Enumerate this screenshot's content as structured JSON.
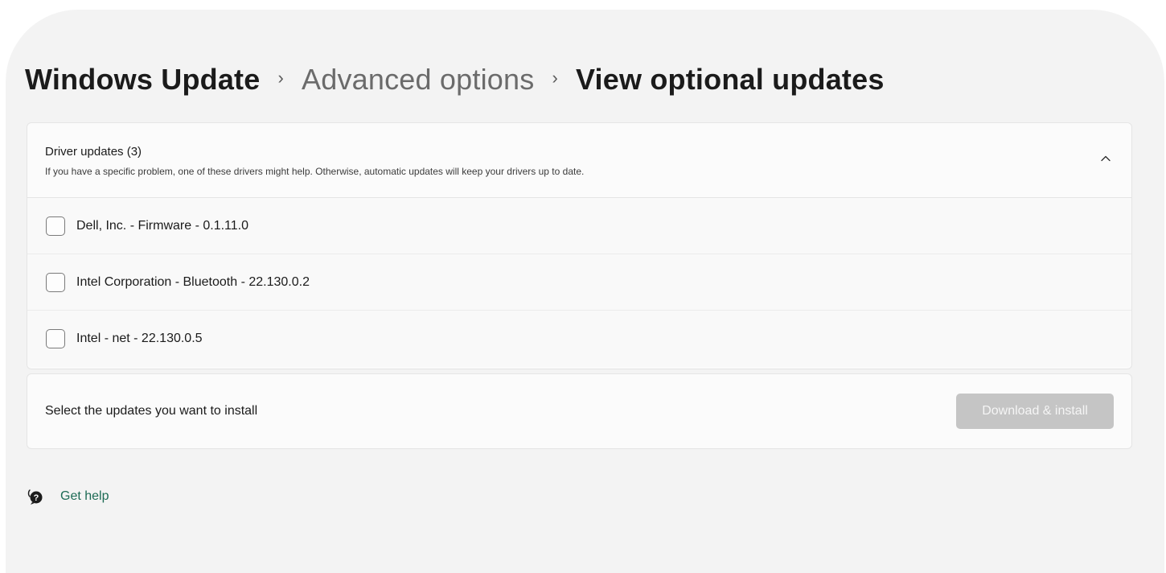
{
  "breadcrumb": {
    "root": "Windows Update",
    "middle": "Advanced options",
    "current": "View optional updates",
    "separator": "›"
  },
  "driver_updates": {
    "title": "Driver updates (3)",
    "description": "If you have a specific problem, one of these drivers might help. Otherwise, automatic updates will keep your drivers up to date.",
    "expanded": true,
    "items": [
      {
        "label": "Dell, Inc. - Firmware - 0.1.11.0",
        "checked": false
      },
      {
        "label": "Intel Corporation - Bluetooth - 22.130.0.2",
        "checked": false
      },
      {
        "label": "Intel - net - 22.130.0.5",
        "checked": false
      }
    ]
  },
  "install": {
    "prompt": "Select the updates you want to install",
    "button_label": "Download & install",
    "button_enabled": false
  },
  "help": {
    "label": "Get help",
    "icon": "help-chat-icon"
  },
  "colors": {
    "background": "#f3f3f3",
    "card": "#fbfbfb",
    "link": "#1d6b55",
    "disabled_button": "#c5c5c5"
  }
}
